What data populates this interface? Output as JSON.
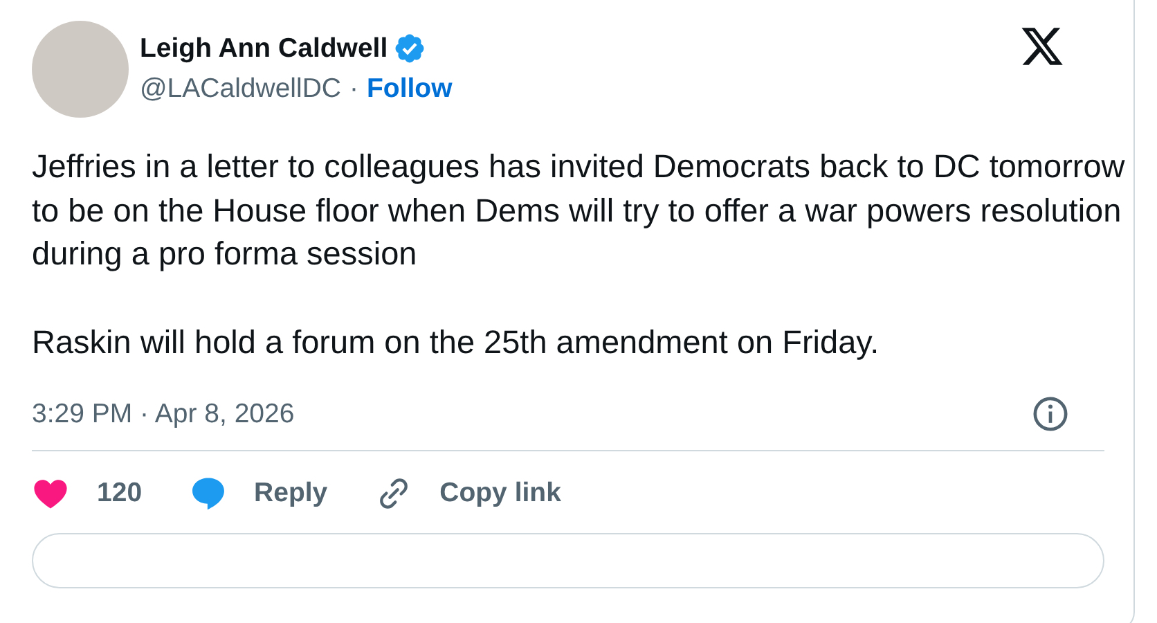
{
  "author": {
    "name": "Leigh Ann Caldwell",
    "handle": "@LACaldwellDC",
    "separator": "·",
    "follow": "Follow"
  },
  "body": [
    "Jeffries in a letter to colleagues has invited Democrats back to DC tomorrow to be on the House floor when Dems will try to offer a war powers resolution during a pro forma session",
    "Raskin will hold a forum on the 25th amendment on Friday."
  ],
  "timestamp": "3:29 PM · Apr 8, 2026",
  "actions": [
    {
      "kind": "like",
      "label": "120"
    },
    {
      "kind": "reply",
      "label": "Reply"
    },
    {
      "kind": "copy",
      "label": "Copy link"
    }
  ]
}
